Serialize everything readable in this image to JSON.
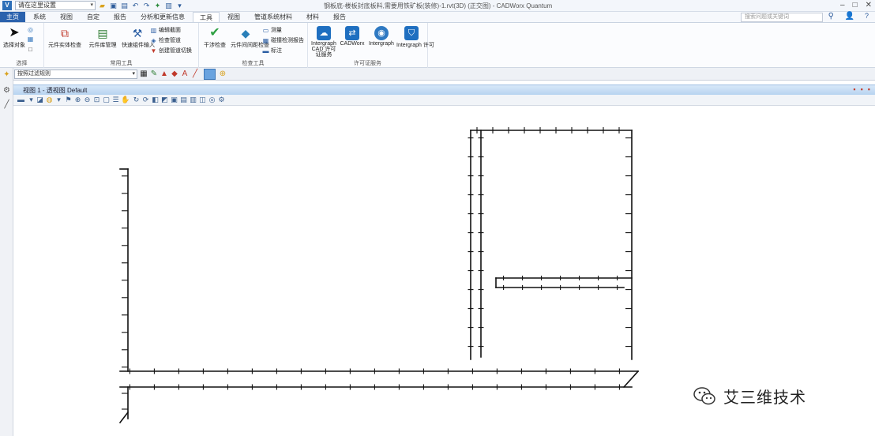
{
  "titlebar": {
    "app_icon": "V",
    "project": "请在这里设置",
    "window_title": "钢板底-楼板封底板料,需要用铁矿板(装修)-1.rvt(3D) (正交图) - CADWorx Quantum"
  },
  "tabs": [
    "主页",
    "系统",
    "视图",
    "自定",
    "报告",
    "分析和更新信息",
    "工具",
    "视图",
    "管道系统材料",
    "材料",
    "报告"
  ],
  "search": {
    "placeholder": "搜索问题或关键词"
  },
  "ribbon": {
    "groups": [
      {
        "label": "选择",
        "buttons": [
          "选择对象"
        ]
      },
      {
        "label": "常用工具",
        "buttons": [
          "元件实体检查",
          "元件库管理",
          "快速组件输入"
        ],
        "small": [
          "编辑截面",
          "检查管道",
          "创建管道切换"
        ]
      },
      {
        "label": "检查工具",
        "buttons": [
          "干涉检查",
          "元件间间距检查"
        ],
        "small": [
          "测量",
          "碰撞检测报告",
          "标注"
        ]
      },
      {
        "label": "许可证服务",
        "buttons": [
          "Intergraph CAD 许可证服务",
          "CADWorx",
          "Intergraph",
          "Intergraph 许可"
        ]
      }
    ]
  },
  "secondary": {
    "filter": "按照过滤规则"
  },
  "view": {
    "title": "视图 1  -  透视图 Default"
  },
  "watermark": {
    "text": "艾三维技术"
  },
  "colors": {
    "file_tab": "#2b62ad",
    "view_bar": "#b7d3f0",
    "drawing": "#111111"
  }
}
